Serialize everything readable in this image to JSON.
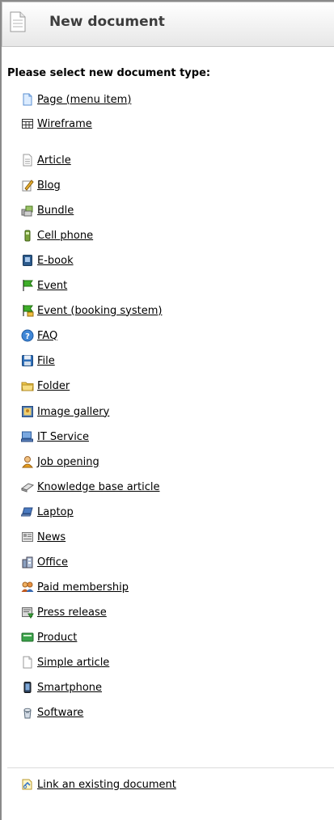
{
  "header": {
    "title": "New document",
    "icon": "document-icon"
  },
  "prompt": "Please select new document type:",
  "primary_types": [
    {
      "label": "Page (menu item)",
      "icon": "page-icon"
    },
    {
      "label": "Wireframe",
      "icon": "wireframe-icon"
    }
  ],
  "types": [
    {
      "label": "Article",
      "icon": "article-icon"
    },
    {
      "label": "Blog",
      "icon": "blog-icon"
    },
    {
      "label": "Bundle",
      "icon": "bundle-icon"
    },
    {
      "label": "Cell phone",
      "icon": "cell-phone-icon"
    },
    {
      "label": "E-book",
      "icon": "ebook-icon"
    },
    {
      "label": "Event",
      "icon": "event-flag-icon"
    },
    {
      "label": "Event (booking system)",
      "icon": "event-booking-icon"
    },
    {
      "label": "FAQ",
      "icon": "faq-icon"
    },
    {
      "label": "File",
      "icon": "file-icon"
    },
    {
      "label": "Folder",
      "icon": "folder-icon"
    },
    {
      "label": "Image gallery",
      "icon": "image-gallery-icon"
    },
    {
      "label": "IT Service",
      "icon": "it-service-icon"
    },
    {
      "label": "Job opening",
      "icon": "job-opening-icon"
    },
    {
      "label": "Knowledge base article",
      "icon": "knowledge-base-icon"
    },
    {
      "label": "Laptop",
      "icon": "laptop-icon"
    },
    {
      "label": "News",
      "icon": "news-icon"
    },
    {
      "label": "Office",
      "icon": "office-icon"
    },
    {
      "label": "Paid membership",
      "icon": "paid-membership-icon"
    },
    {
      "label": "Press release",
      "icon": "press-release-icon"
    },
    {
      "label": "Product",
      "icon": "product-icon"
    },
    {
      "label": "Simple article",
      "icon": "simple-article-icon"
    },
    {
      "label": "Smartphone",
      "icon": "smartphone-icon"
    },
    {
      "label": "Software",
      "icon": "software-icon"
    }
  ],
  "footer": {
    "link_label": "Link an existing document",
    "icon": "link-document-icon"
  }
}
